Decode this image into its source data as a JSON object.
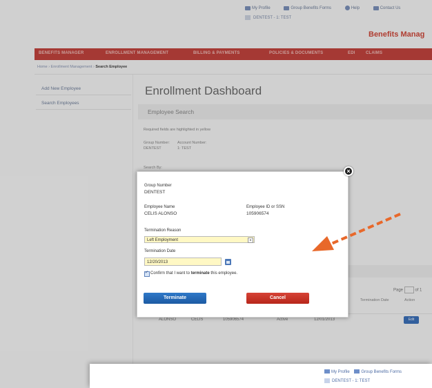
{
  "header": {
    "links": [
      "My Profile",
      "Group Benefits Forms",
      "Help",
      "Contact Us"
    ],
    "account": "DENTEST - 1: TEST",
    "app_title": "Benefits Manag"
  },
  "nav": {
    "items": [
      "BENEFITS MANAGER",
      "ENROLLMENT MANAGEMENT",
      "BILLING & PAYMENTS",
      "POLICIES & DOCUMENTS",
      "EDI",
      "CLAIMS"
    ]
  },
  "breadcrumb": {
    "path": "Home › Enrollment Management › ",
    "current": "Search Employee"
  },
  "sidebar": {
    "items": [
      {
        "label": "Add New Employee"
      },
      {
        "label": "Search Employees"
      }
    ]
  },
  "main": {
    "title": "Enrollment Dashboard",
    "section": "Employee Search",
    "required_note": "Required fields are highlighted in yellow",
    "group_number_label": "Group Number:",
    "group_number_value": "DENTEST",
    "account_number_label": "Account Number:",
    "account_number_value": "1: TEST",
    "search_by": "Search By:",
    "pager": {
      "label": "Page",
      "of": "of 1"
    },
    "columns": [
      "Termination Date",
      "Action"
    ],
    "row": {
      "last": "ALONSO",
      "first": "CELIS",
      "id": "105906574",
      "status": "Active",
      "date": "12/01/2013",
      "action": "Edit"
    }
  },
  "modal": {
    "close": "×",
    "group_number_label": "Group Number",
    "group_number_value": "DENTEST",
    "employee_name_label": "Employee Name",
    "employee_name_value": "CELIS ALONSO",
    "employee_id_label": "Employee ID or SSN",
    "employee_id_value": "105906574",
    "termination_reason_label": "Termination Reason",
    "termination_reason_value": "Left Employment",
    "termination_date_label": "Termination Date",
    "termination_date_value": "12/20/2013",
    "confirm_prefix": "Confirm that I want to ",
    "confirm_bold": "terminate",
    "confirm_suffix": " this employee.",
    "terminate_button": "Terminate",
    "cancel_button": "Cancel"
  },
  "overlay": {
    "links": [
      "My Profile",
      "Group Benefits Forms"
    ],
    "account": "DENTEST - 1: TEST"
  },
  "colors": {
    "nav": "#c7453f",
    "accent_blue": "#1c5aa3",
    "cancel_red": "#b7261a",
    "arrow": "#e8682a",
    "field_required": "#fff8c4"
  }
}
